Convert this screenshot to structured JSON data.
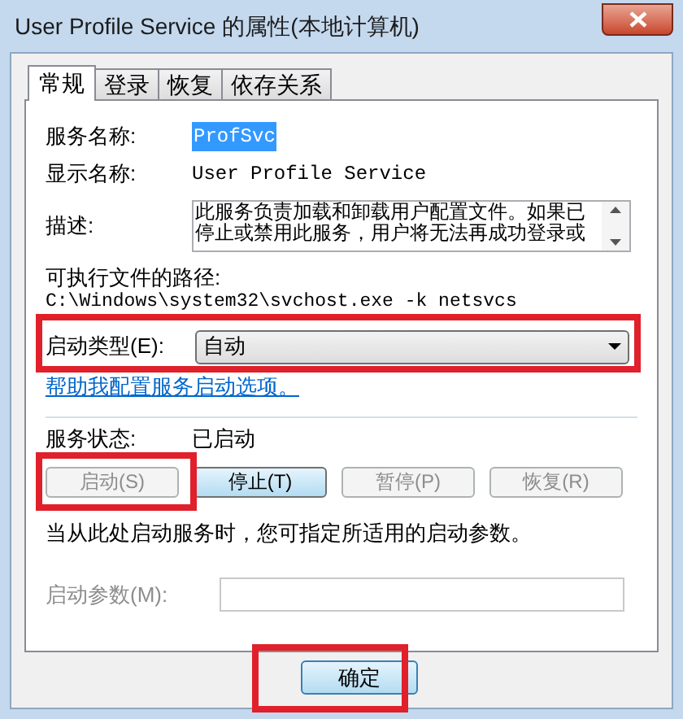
{
  "window": {
    "title": "User Profile Service 的属性(本地计算机)"
  },
  "tabs": [
    {
      "label": "常规",
      "selected": true
    },
    {
      "label": "登录",
      "selected": false
    },
    {
      "label": "恢复",
      "selected": false
    },
    {
      "label": "依存关系",
      "selected": false
    }
  ],
  "service_name": {
    "label": "服务名称:",
    "value": "ProfSvc",
    "selected": true
  },
  "display_name": {
    "label": "显示名称:",
    "value": "User Profile Service"
  },
  "description": {
    "label": "描述:",
    "value": "此服务负责加载和卸载用户配置文件。如果已停止或禁用此服务，用户将无法再成功登录或"
  },
  "executable_path": {
    "label": "可执行文件的路径:",
    "value": "C:\\Windows\\system32\\svchost.exe -k netsvcs"
  },
  "startup_type": {
    "label": "启动类型(E):",
    "value": "自动"
  },
  "help_link": "帮助我配置服务启动选项。",
  "service_status": {
    "label": "服务状态:",
    "value": "已启动"
  },
  "service_buttons": [
    {
      "label": "启动(S)",
      "disabled": true,
      "focused": false
    },
    {
      "label": "停止(T)",
      "disabled": false,
      "focused": true
    },
    {
      "label": "暂停(P)",
      "disabled": true,
      "focused": false
    },
    {
      "label": "恢复(R)",
      "disabled": true,
      "focused": false
    }
  ],
  "hint": "当从此处启动服务时，您可指定所适用的启动参数。",
  "start_parameters": {
    "label": "启动参数(M):",
    "disabled": true
  },
  "dialog_buttons": [
    {
      "label": "确定",
      "default": true
    }
  ]
}
